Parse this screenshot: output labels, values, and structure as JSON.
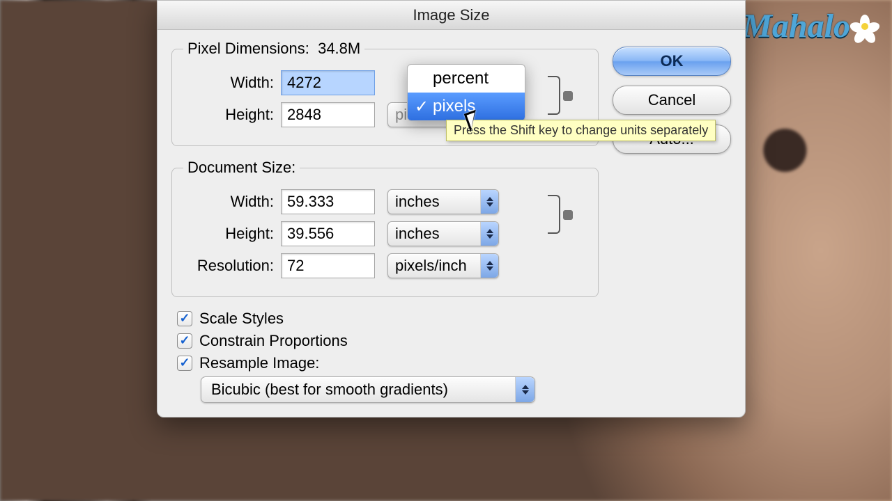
{
  "logo": "Mahalo",
  "dialog": {
    "title": "Image Size",
    "pixel_dimensions": {
      "legend": "Pixel Dimensions:",
      "size": "34.8M",
      "width_label": "Width:",
      "height_label": "Height:",
      "width_value": "4272",
      "height_value": "2848",
      "unit_options": {
        "percent": "percent",
        "pixels": "pixels"
      },
      "height_unit_partial": "pi"
    },
    "document_size": {
      "legend": "Document Size:",
      "width_label": "Width:",
      "height_label": "Height:",
      "resolution_label": "Resolution:",
      "width_value": "59.333",
      "height_value": "39.556",
      "resolution_value": "72",
      "width_unit": "inches",
      "height_unit": "inches",
      "resolution_unit": "pixels/inch"
    },
    "checks": {
      "scale_styles": "Scale Styles",
      "constrain": "Constrain Proportions",
      "resample": "Resample Image:"
    },
    "method_select": "Bicubic (best for smooth gradients)",
    "buttons": {
      "ok": "OK",
      "cancel": "Cancel",
      "auto": "Auto..."
    },
    "tooltip": "Press the Shift key to change units separately"
  }
}
